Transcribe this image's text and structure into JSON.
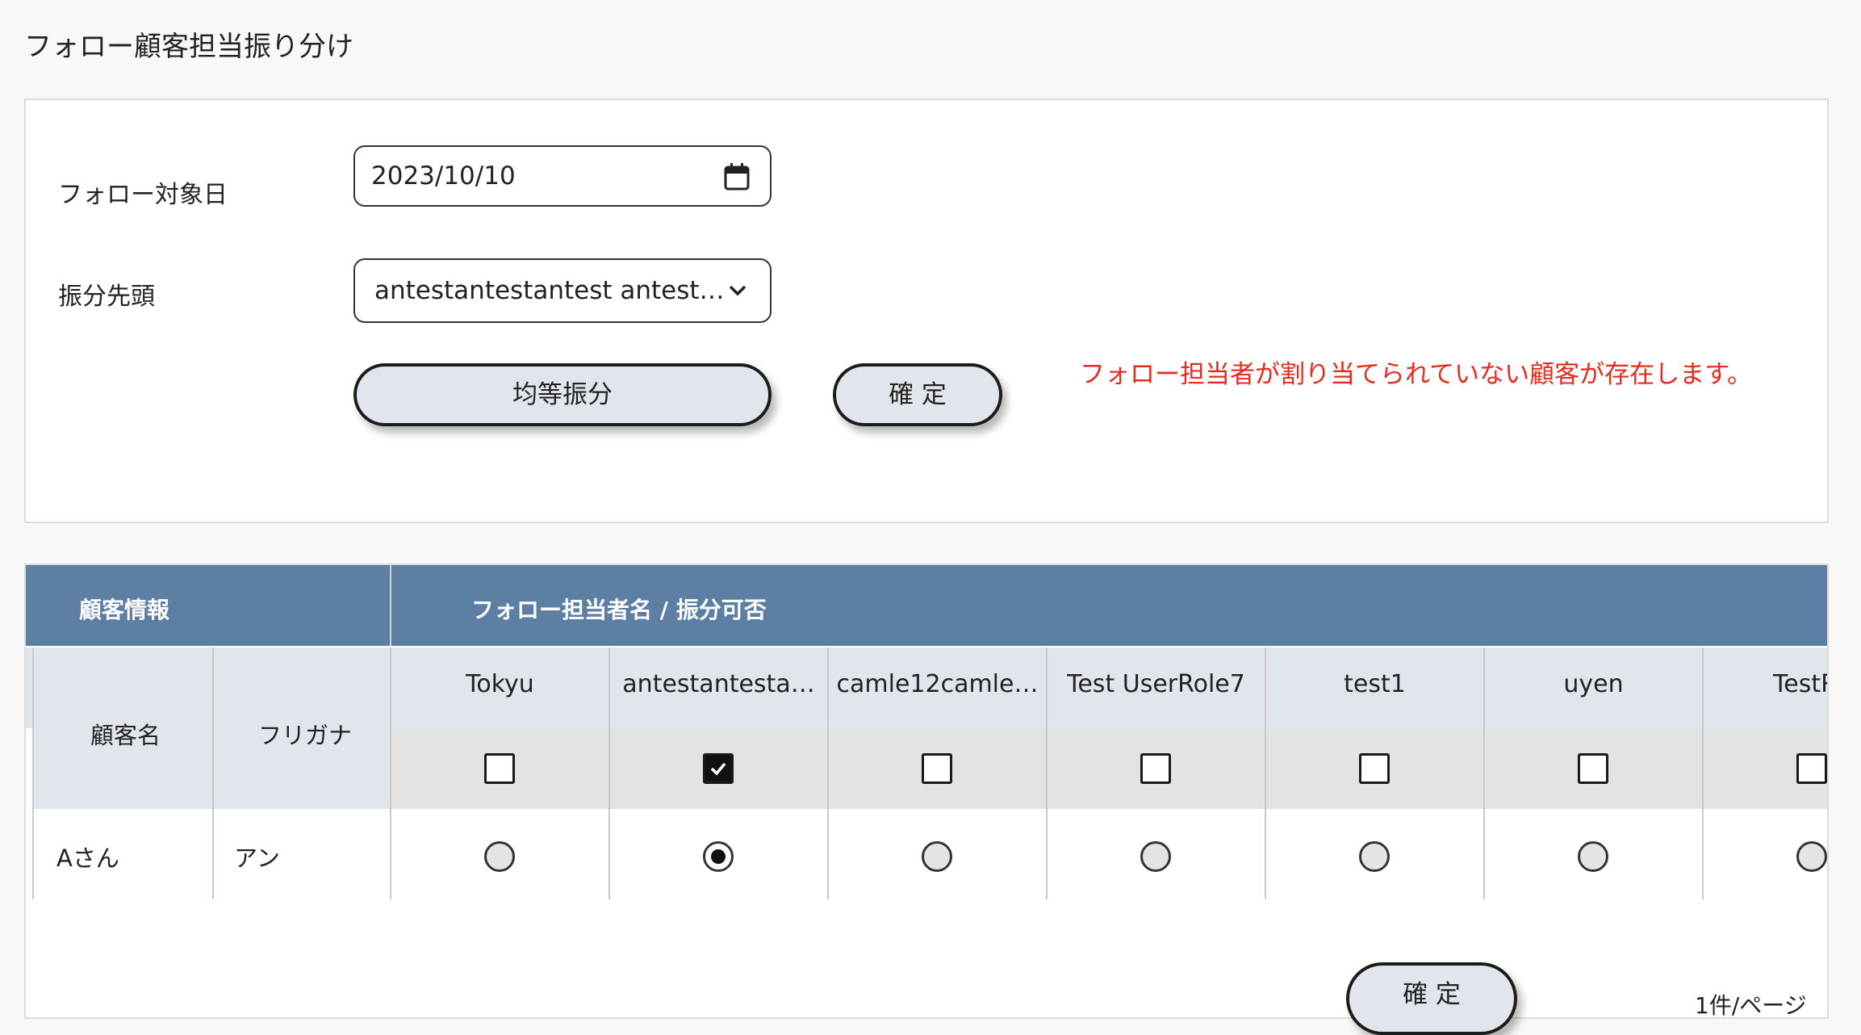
{
  "page": {
    "title": "フォロー顧客担当振り分け"
  },
  "form": {
    "target_date_label": "フォロー対象日",
    "target_date_value": "2023/10/10",
    "lead_label": "振分先頭",
    "lead_value": "antestantestantest antest…",
    "equal_button": "均等振分",
    "confirm_button": "確 定",
    "warning": "フォロー担当者が割り当てられていない顧客が存在します。",
    "warning_color": "#e52b1e"
  },
  "table": {
    "header_color": "#5d7fa3",
    "group_customer": "顧客情報",
    "group_staff": "フォロー担当者名 / 振分可否",
    "col_customer_name": "顧客名",
    "col_furigana": "フリガナ",
    "staff": [
      {
        "name": "Tokyu",
        "allowed": false
      },
      {
        "name": "antestantesta…",
        "allowed": true
      },
      {
        "name": "camle12camle…",
        "allowed": false
      },
      {
        "name": "Test UserRole7",
        "allowed": false
      },
      {
        "name": "test1",
        "allowed": false
      },
      {
        "name": "uyen",
        "allowed": false
      },
      {
        "name": "TestRo",
        "allowed": false
      }
    ],
    "rows": [
      {
        "customer_name": "Aさん",
        "furigana": "アン",
        "assigned_index": 1
      }
    ]
  },
  "footer": {
    "confirm_button": "確 定",
    "per_page": "1件/ページ"
  },
  "icons": {
    "date_picker": "calendar-icon",
    "dropdown": "chevron-down-icon",
    "checked": "checkmark-icon"
  }
}
